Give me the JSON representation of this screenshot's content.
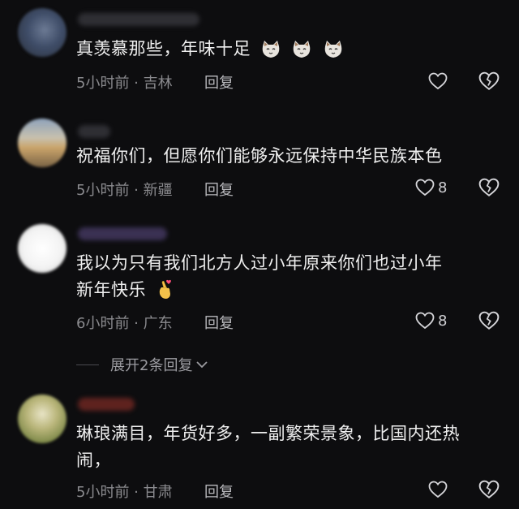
{
  "comments": [
    {
      "text_lines": [
        "真羡慕那些，年味十足"
      ],
      "emoji": [
        "cat-face-emoji",
        "cat-face-emoji",
        "cat-face-emoji"
      ],
      "meta": "5小时前 · 吉林",
      "reply": "回复",
      "likes": ""
    },
    {
      "text_lines": [
        "祝福你们，但愿你们能够永远保持中华民族本色"
      ],
      "meta": "5小时前 · 新疆",
      "reply": "回复",
      "likes": "8"
    },
    {
      "text_lines": [
        "我以为只有我们北方人过小年原来你们也过小年",
        "新年快乐"
      ],
      "emoji": [
        "finger-heart-emoji"
      ],
      "meta": "6小时前 · 广东",
      "reply": "回复",
      "likes": "8"
    },
    {
      "text_lines": [
        "琳琅满目，年货好多，一副繁荣景象，比国内还热",
        "闹，"
      ],
      "meta": "5小时前 · 甘肃",
      "reply": "回复",
      "likes": ""
    }
  ],
  "expand_replies": "展开2条回复",
  "colors": {
    "background": "#0d0d0f",
    "text": "#efefef",
    "meta": "#8a8a8e"
  }
}
